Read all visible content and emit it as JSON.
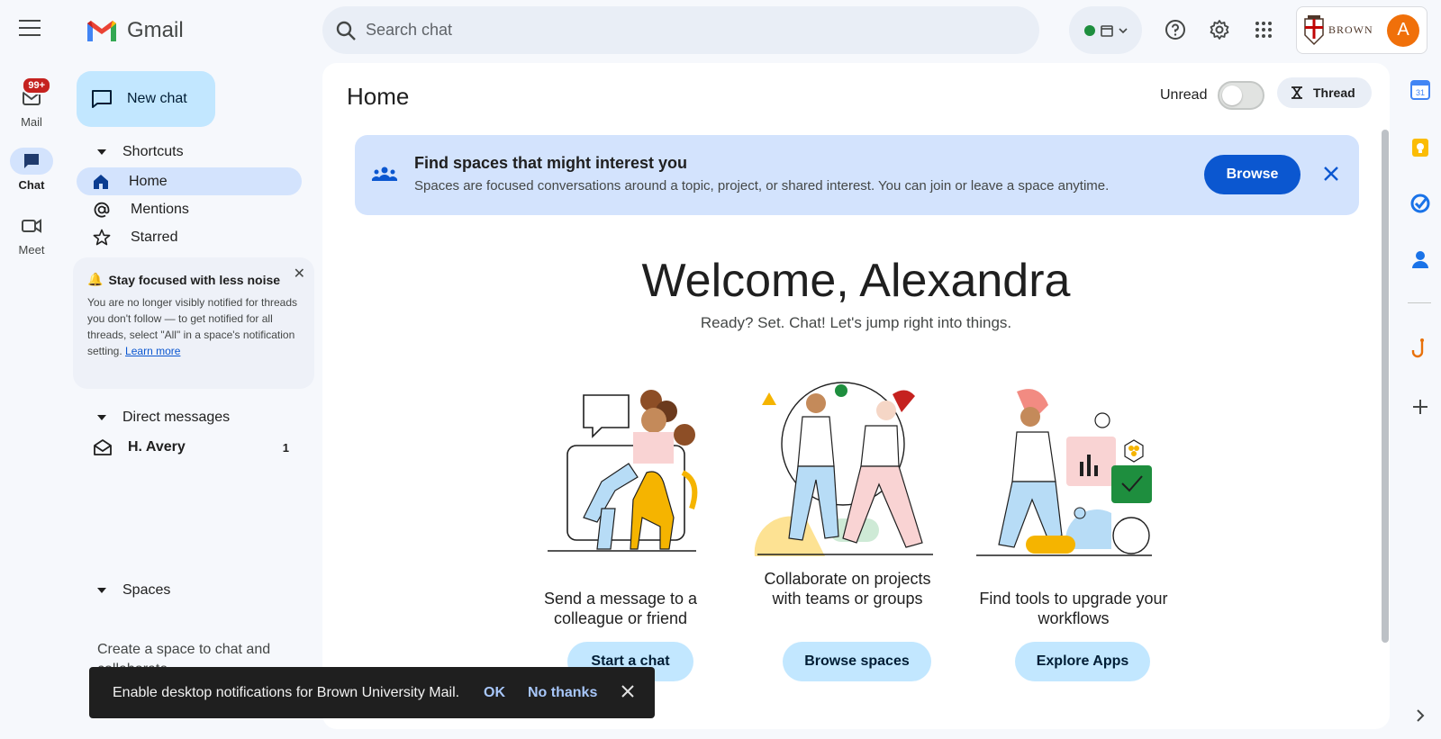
{
  "app": {
    "name": "Gmail"
  },
  "rail": {
    "items": [
      {
        "label": "Mail",
        "badge": "99+"
      },
      {
        "label": "Chat"
      },
      {
        "label": "Meet"
      }
    ]
  },
  "search": {
    "placeholder": "Search chat"
  },
  "account": {
    "org": "BROWN",
    "avatar_letter": "A",
    "status_color": "#1e8e3e"
  },
  "sidebar": {
    "new_chat": "New chat",
    "shortcuts_header": "Shortcuts",
    "shortcuts": [
      {
        "label": "Home",
        "active": true
      },
      {
        "label": "Mentions"
      },
      {
        "label": "Starred"
      }
    ],
    "focus_card": {
      "title": "Stay focused with less noise",
      "body": "You are no longer visibly notified for threads you don't follow — to get notified for all threads, select \"All\" in a space's notification setting.",
      "link": "Learn more"
    },
    "dm_header": "Direct messages",
    "dms": [
      {
        "name": "H. Avery",
        "count": "1"
      }
    ],
    "spaces_header": "Spaces",
    "spaces_empty": "Create a space to chat and collaborate"
  },
  "main": {
    "title": "Home",
    "unread_label": "Unread",
    "thread_label": "Thread",
    "banner": {
      "title": "Find spaces that might interest you",
      "body": "Spaces are focused conversations around a topic, project, or shared interest. You can join or leave a space anytime.",
      "button": "Browse"
    },
    "welcome": "Welcome, Alexandra",
    "subtitle": "Ready? Set. Chat! Let's jump right into things.",
    "features": [
      {
        "text": "Send a message to a colleague or friend",
        "button": "Start a chat"
      },
      {
        "text": "Collaborate on projects with teams or groups",
        "button": "Browse spaces"
      },
      {
        "text": "Find tools to upgrade your workflows",
        "button": "Explore Apps"
      }
    ]
  },
  "snackbar": {
    "message": "Enable desktop notifications for Brown University Mail.",
    "ok": "OK",
    "no_thanks": "No thanks"
  },
  "colors": {
    "accent": "#0b57d0",
    "active_bg": "#d3e3fd",
    "button_bg": "#c2e7ff",
    "avatar": "#f0700a"
  }
}
